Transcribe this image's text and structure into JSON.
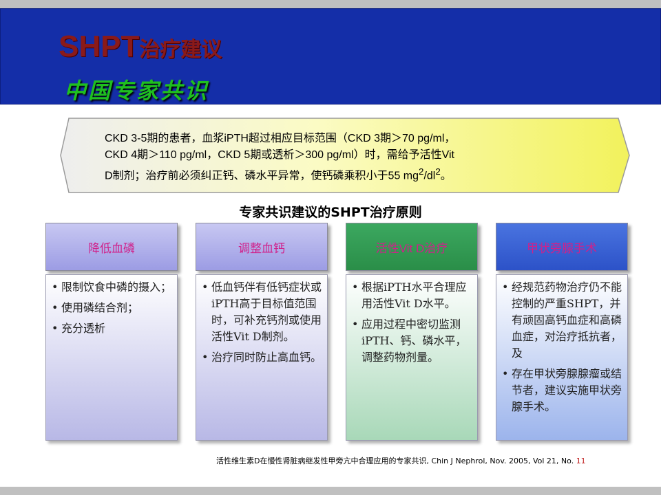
{
  "header": {
    "title_latin": "SHPT",
    "title_cn": "治疗建议",
    "subtitle": "中国专家共识"
  },
  "callout": {
    "line1": "CKD 3-5期的患者，血浆iPTH超过相应目标范围（CKD 3期＞70 pg/ml，",
    "line2": "CKD 4期＞110 pg/ml，CKD 5期或透析＞300 pg/ml）时，需给予活性Vit",
    "line3_a": "D制剂；治疗前必须纠正钙、磷水平异常，使钙磷乘积小于55 mg",
    "sup1": "2",
    "line3_b": "/dl",
    "sup2": "2",
    "line3_c": "。"
  },
  "section_title": "专家共识建议的SHPT治疗原则",
  "columns": [
    {
      "header": "降低血磷",
      "items": [
        "限制饮食中磷的摄入；",
        "使用磷结合剂；",
        "充分透析"
      ]
    },
    {
      "header": "调整血钙",
      "items": [
        "低血钙伴有低钙症状或iPTH高于目标值范围时，可补充钙剂或使用活性Vit D制剂。",
        "治疗同时防止高血钙。"
      ]
    },
    {
      "header": "活性Vit D治疗",
      "items": [
        "根据iPTH水平合理应用活性Vit D水平。",
        "应用过程中密切监测iPTH、钙、磷水平，调整药物剂量。"
      ]
    },
    {
      "header": "甲状旁腺手术",
      "items": [
        "经规范药物治疗仍不能控制的严重SHPT，并有顽固高钙血症和高磷血症，对治疗抵抗者，及",
        "存在甲状旁腺腺瘤或结节者，建议实施甲状旁腺手术。"
      ]
    }
  ],
  "citation": {
    "text": "活性维生素D在慢性肾脏病继发性甲旁亢中合理应用的专家共识, Chin J Nephrol, Nov. 2005, Vol 21, No. ",
    "page": "11"
  },
  "colors": {
    "header_bg": "#142ea8",
    "title": "#8a1a1a",
    "subtitle": "#1fbf1f",
    "column_header_text": "#d0208a",
    "callout_fill": "#fbfbc0"
  }
}
